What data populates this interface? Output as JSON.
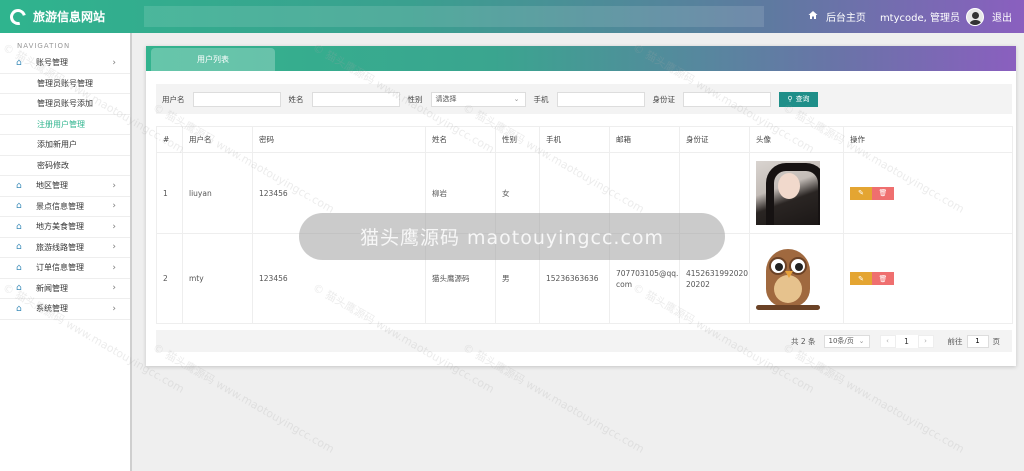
{
  "header": {
    "site_title": "旅游信息网站",
    "home_label": "后台主页",
    "user_label": "mtycode, 管理员",
    "logout_label": "退出",
    "accent": "#2fb48e"
  },
  "sidebar": {
    "nav_title": "NAVIGATION",
    "account": {
      "label": "账号管理",
      "icon": "home-icon"
    },
    "account_sub": [
      "管理员账号管理",
      "管理员账号添加",
      "注册用户管理",
      "添加新用户",
      "密码修改"
    ],
    "active_sub": "注册用户管理",
    "sections": [
      "地区管理",
      "景点信息管理",
      "地方美食管理",
      "旅游线路管理",
      "订单信息管理",
      "新闻管理",
      "系统管理"
    ]
  },
  "panel": {
    "tab_label": "用户列表"
  },
  "search": {
    "username_label": "用户名",
    "name_label": "姓名",
    "gender_label": "性别",
    "gender_value": "请选择",
    "phone_label": "手机",
    "idcard_label": "身份证",
    "query_label": "查询"
  },
  "table": {
    "headers": [
      "#",
      "用户名",
      "密码",
      "姓名",
      "性别",
      "手机",
      "邮箱",
      "身份证",
      "头像",
      "操作"
    ],
    "rows": [
      {
        "index": "1",
        "username": "liuyan",
        "password": "123456",
        "name": "柳岩",
        "gender": "女",
        "phone": "",
        "email": "",
        "idcard": "",
        "avatar": "avatar-photo"
      },
      {
        "index": "2",
        "username": "mty",
        "password": "123456",
        "name": "猫头鹰源码",
        "gender": "男",
        "phone": "15236363636",
        "email": "707703105@qq.com",
        "idcard": "415263199202020202",
        "avatar": "owl-avatar"
      }
    ],
    "edit_icon": "edit-icon",
    "delete_icon": "delete-icon"
  },
  "pagination": {
    "total": "共 2 条",
    "page_size": "10条/页",
    "current_page": "1",
    "goto_label": "前往",
    "goto_value": "1",
    "page_suffix": "页"
  },
  "watermark": {
    "banner": "猫头鹰源码 maotouyingcc.com",
    "tile": "© 猫头鹰源码 www.maotouyingcc.com"
  }
}
